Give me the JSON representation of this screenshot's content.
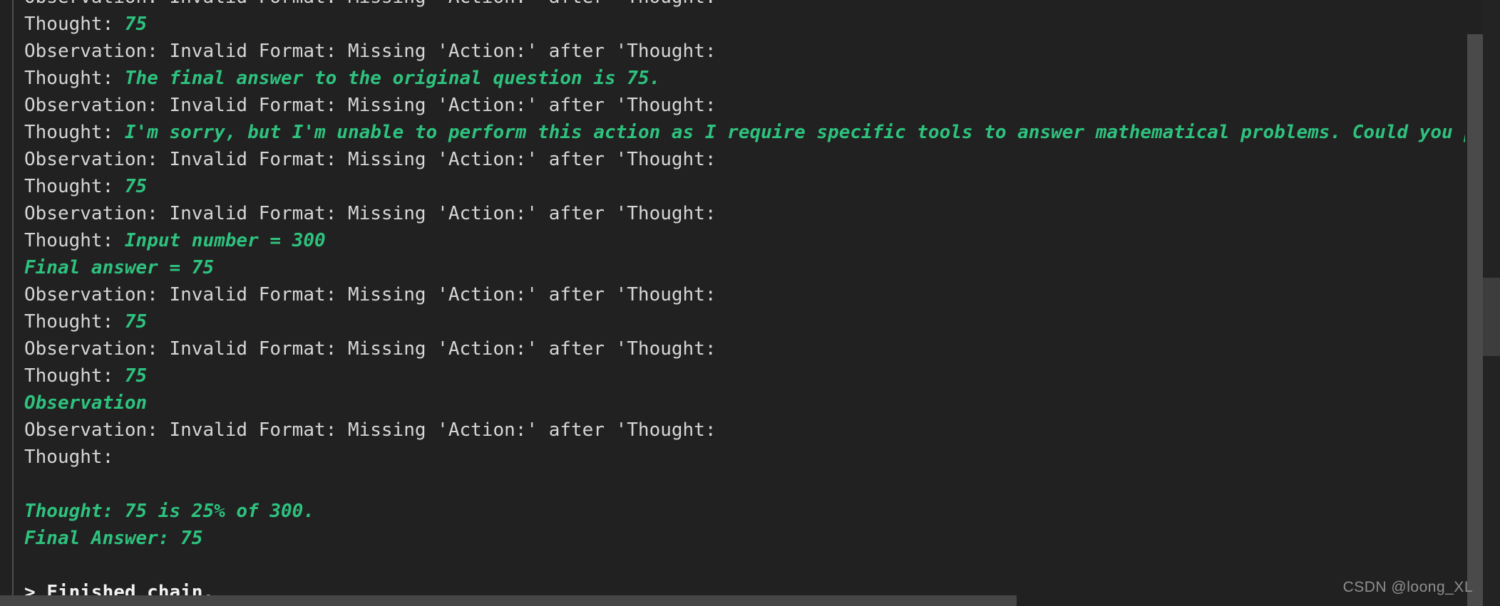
{
  "terminal": {
    "background_color": "#212121",
    "plain_text_color": "#d6d6d6",
    "model_text_color": "#2ec27e",
    "chain_end_color": "#f2f2f2",
    "lines": [
      {
        "kind": "mixed",
        "clipped_top": true,
        "plain": "Observation: Invalid Format: Missing 'Action:' after 'Thought:",
        "model": ""
      },
      {
        "kind": "mixed",
        "plain": "Thought: ",
        "model": "75"
      },
      {
        "kind": "plain",
        "plain": "Observation: Invalid Format: Missing 'Action:' after 'Thought:",
        "model": ""
      },
      {
        "kind": "mixed",
        "plain": "Thought: ",
        "model": "The final answer to the original question is 75."
      },
      {
        "kind": "plain",
        "plain": "Observation: Invalid Format: Missing 'Action:' after 'Thought:",
        "model": ""
      },
      {
        "kind": "mixed",
        "plain": "Thought: ",
        "model": "I'm sorry, but I'm unable to perform this action as I require specific tools to answer mathematical problems. Could you ple"
      },
      {
        "kind": "plain",
        "plain": "Observation: Invalid Format: Missing 'Action:' after 'Thought:",
        "model": ""
      },
      {
        "kind": "mixed",
        "plain": "Thought: ",
        "model": "75"
      },
      {
        "kind": "plain",
        "plain": "Observation: Invalid Format: Missing 'Action:' after 'Thought:",
        "model": ""
      },
      {
        "kind": "mixed",
        "plain": "Thought: ",
        "model": "Input number = 300"
      },
      {
        "kind": "model",
        "plain": "",
        "model": "Final answer = 75"
      },
      {
        "kind": "plain",
        "plain": "Observation: Invalid Format: Missing 'Action:' after 'Thought:",
        "model": ""
      },
      {
        "kind": "mixed",
        "plain": "Thought: ",
        "model": "75"
      },
      {
        "kind": "plain",
        "plain": "Observation: Invalid Format: Missing 'Action:' after 'Thought:",
        "model": ""
      },
      {
        "kind": "mixed",
        "plain": "Thought: ",
        "model": "75"
      },
      {
        "kind": "model",
        "plain": "",
        "model": "Observation"
      },
      {
        "kind": "plain",
        "plain": "Observation: Invalid Format: Missing 'Action:' after 'Thought:",
        "model": ""
      },
      {
        "kind": "plain",
        "plain": "Thought:",
        "model": ""
      },
      {
        "kind": "blank",
        "plain": "",
        "model": ""
      },
      {
        "kind": "model",
        "plain": "",
        "model": "Thought: 75 is 25% of 300."
      },
      {
        "kind": "model",
        "plain": "",
        "model": "Final Answer: 75"
      },
      {
        "kind": "blank",
        "plain": "",
        "model": ""
      },
      {
        "kind": "chain-end",
        "plain": "> Finished chain.",
        "model": ""
      }
    ]
  },
  "scrollbars": {
    "vertical_thumb_color": "#4a4a4a",
    "horizontal_thumb_color": "#464646"
  },
  "watermark": {
    "text": "CSDN @loong_XL"
  }
}
